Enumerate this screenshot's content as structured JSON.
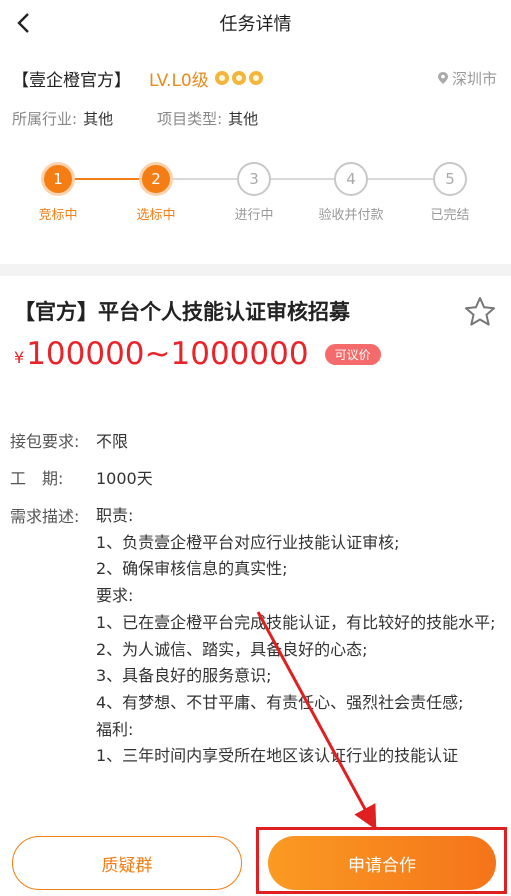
{
  "nav": {
    "title": "任务详情"
  },
  "company": {
    "name": "【壹企橙官方】",
    "level": "LV.L0级",
    "location": "深圳市"
  },
  "meta": {
    "industry_label": "所属行业:",
    "industry_value": "其他",
    "type_label": "项目类型:",
    "type_value": "其他"
  },
  "steps": [
    {
      "num": "1",
      "label": "竞标中",
      "active": true
    },
    {
      "num": "2",
      "label": "选标中",
      "active": true
    },
    {
      "num": "3",
      "label": "进行中",
      "active": false
    },
    {
      "num": "4",
      "label": "验收并付款",
      "active": false
    },
    {
      "num": "5",
      "label": "已完结",
      "active": false
    }
  ],
  "task": {
    "title": "【官方】平台个人技能认证审核招募",
    "currency": "¥",
    "price": "100000~1000000",
    "negotiable": "可议价"
  },
  "details": {
    "contract_label": "接包要求:",
    "contract_value": "不限",
    "period_label": "工　期:",
    "period_value": "1000天",
    "desc_label": "需求描述:",
    "desc_lines": [
      "职责:",
      "1、负责壹企橙平台对应行业技能认证审核;",
      "2、确保审核信息的真实性;",
      "要求:",
      "1、已在壹企橙平台完成技能认证，有比较好的技能水平;",
      "2、为人诚信、踏实，具备良好的心态;",
      "3、具备良好的服务意识;",
      "4、有梦想、不甘平庸、有责任心、强烈社会责任感;",
      "福利:",
      "1、三年时间内享受所在地区该认证行业的技能认证"
    ]
  },
  "buttons": {
    "group": "质疑群",
    "apply": "申请合作"
  },
  "colors": {
    "accent": "#f57e14",
    "price": "#e8242a",
    "highlight": "#e02020"
  }
}
